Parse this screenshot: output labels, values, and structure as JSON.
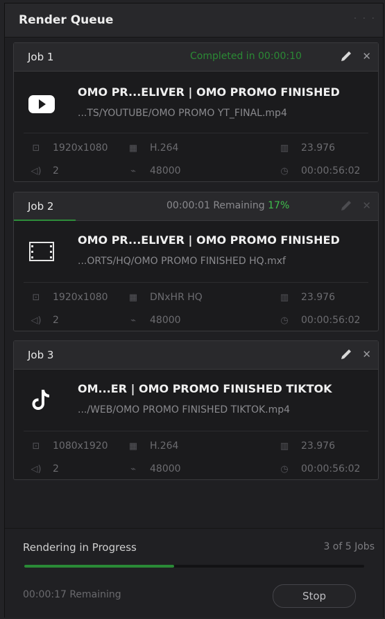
{
  "header": {
    "title": "Render Queue",
    "menu": "· · ·"
  },
  "jobs": [
    {
      "name": "Job 1",
      "status": "Completed in 00:00:10",
      "status_color": "#2b8a35",
      "thumb_icon": "youtube-icon",
      "title": "OMO PR...ELIVER | OMO PROMO FINISHED",
      "path": "...TS/YOUTUBE/OMO PROMO YT_FINAL.mp4",
      "resolution": "1920x1080",
      "codec": "H.264",
      "fps": "23.976",
      "audio_channels": "2",
      "sample_rate": "48000",
      "duration": "00:00:56:02"
    },
    {
      "name": "Job 2",
      "status": "00:00:01 Remaining",
      "percent": "17%",
      "percent_color": "#3fbf4c",
      "progress": 0.17,
      "thumb_icon": "film-strip-icon",
      "title": "OMO PR...ELIVER | OMO PROMO FINISHED",
      "path": "...ORTS/HQ/OMO PROMO FINISHED HQ.mxf",
      "resolution": "1920x1080",
      "codec": "DNxHR HQ",
      "fps": "23.976",
      "audio_channels": "2",
      "sample_rate": "48000",
      "duration": "00:00:56:02"
    },
    {
      "name": "Job 3",
      "status": "",
      "thumb_icon": "tiktok-icon",
      "title": "OM...ER | OMO PROMO FINISHED TIKTOK",
      "path": ".../WEB/OMO PROMO FINISHED TIKTOK.mp4",
      "resolution": "1080x1920",
      "codec": "H.264",
      "fps": "23.976",
      "audio_channels": "2",
      "sample_rate": "48000",
      "duration": "00:00:56:02"
    }
  ],
  "footer": {
    "status": "Rendering in Progress",
    "jobs_count": "3 of 5 Jobs",
    "progress": 0.44,
    "remaining": "00:00:17 Remaining",
    "stop_label": "Stop"
  },
  "colors": {
    "accent_green": "#2b8a35",
    "background": "#1f1f22"
  }
}
